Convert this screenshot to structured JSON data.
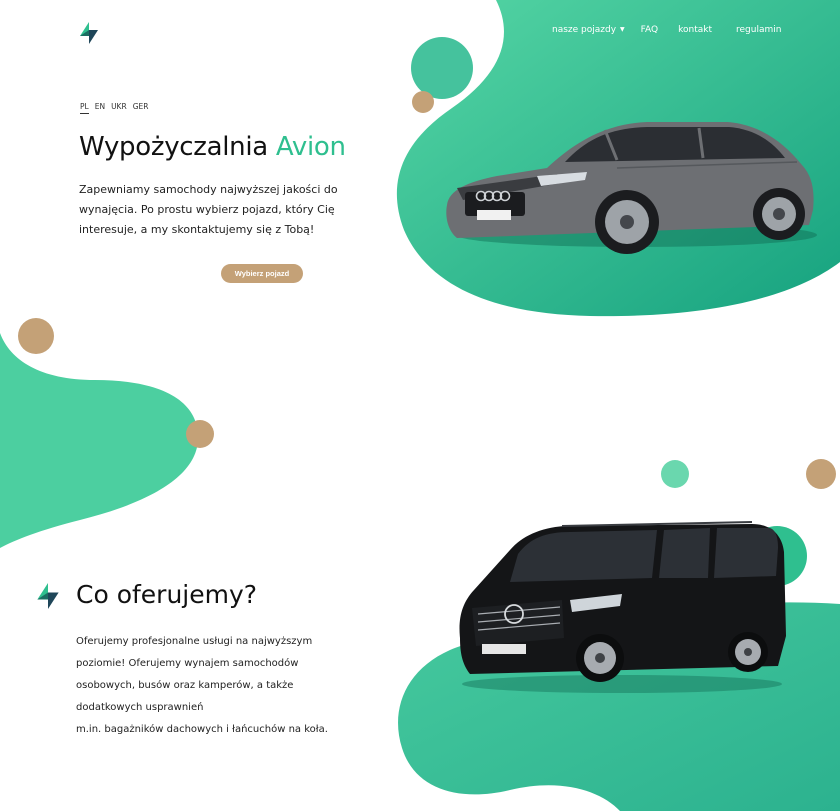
{
  "brand": {
    "logo_icon": "avion-logo-icon",
    "colors": {
      "green": "#4ccfa0",
      "dark_green": "#17a57f",
      "tan": "#c4a177",
      "navy": "#1f4659",
      "text": "#111111"
    }
  },
  "nav": {
    "items": [
      {
        "label": "nasze pojazdy",
        "has_dropdown": true
      },
      {
        "label": "FAQ"
      },
      {
        "label": "kontakt"
      },
      {
        "label": "regulamin"
      }
    ]
  },
  "languages": {
    "items": [
      "PL",
      "EN",
      "UKR",
      "GER"
    ],
    "active": "PL"
  },
  "hero": {
    "title_main": "Wypożyczalnia",
    "title_accent": "Avion",
    "text": "Zapewniamy samochody najwyższej jakości do wynajęcia. Po prostu wybierz pojazd, który Cię interesuje, a my skontaktujemy się z Tobą!",
    "cta_label": "Wybierz pojazd",
    "car_icon": "sedan-car-icon"
  },
  "offer": {
    "title": "Co oferujemy?",
    "lines": [
      "Oferujemy profesjonalne usługi na najwyższym",
      "poziomie! Oferujemy wynajem samochodów",
      "osobowych, busów oraz kamperów, a także",
      "dodatkowych usprawnień",
      "m.in. bagażników dachowych i łańcuchów na koła."
    ],
    "car_icon": "van-car-icon"
  }
}
